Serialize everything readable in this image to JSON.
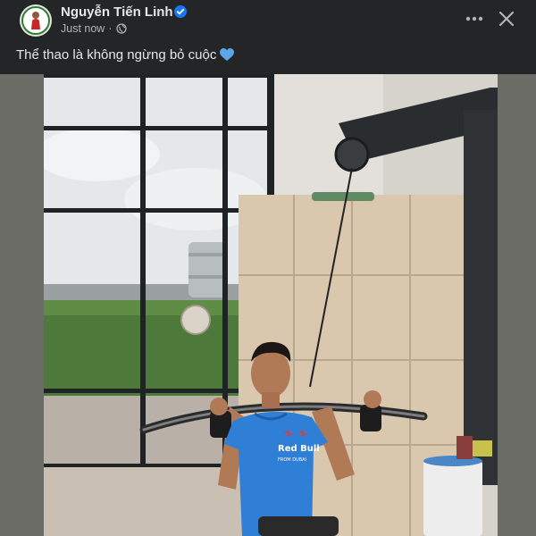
{
  "post": {
    "author": "Nguyễn Tiến Linh",
    "timestamp": "Just now",
    "separator": "·",
    "caption": "Thể thao là không ngừng bỏ cuộc",
    "more_label": "•••",
    "close_label": "✕"
  },
  "photo": {
    "shirt_brand": "Red Bull",
    "shirt_subtext": "FROM DUBAI"
  },
  "icons": {
    "verified": "verified-badge-icon",
    "privacy": "globe-icon",
    "emoji": "blue-heart-icon",
    "more": "more-options-icon",
    "close": "close-icon"
  },
  "colors": {
    "background": "#242526",
    "text_primary": "#e4e6eb",
    "text_secondary": "#b0b3b8",
    "verified_blue": "#1877f2",
    "heart_blue": "#5aa6e6",
    "shirt_blue": "#2f7fd6"
  }
}
